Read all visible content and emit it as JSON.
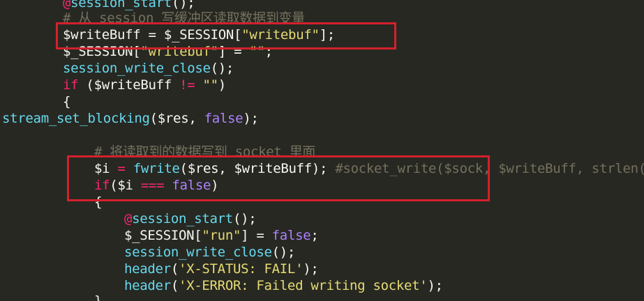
{
  "editor": {
    "language": "php",
    "theme_colors": {
      "background": "#272822",
      "keyword": "#f92672",
      "string": "#e6db74",
      "function": "#66d9ef",
      "comment": "#75715e",
      "boolean": "#ae81ff",
      "plain": "#f8f8f2",
      "annotation_box": "#d3212c"
    },
    "lines": [
      {
        "tokens": [
          {
            "t": "@",
            "c": "k"
          },
          {
            "t": "session_start",
            "c": "f"
          },
          {
            "t": "();",
            "c": "p"
          }
        ]
      },
      {
        "tokens": [
          {
            "t": "# 从 session 写缓冲区读取数据到变量",
            "c": "c"
          }
        ]
      },
      {
        "tokens": [
          {
            "t": "$writeBuff",
            "c": "v"
          },
          {
            "t": " = ",
            "c": "p"
          },
          {
            "t": "$_SESSION",
            "c": "v"
          },
          {
            "t": "[",
            "c": "p"
          },
          {
            "t": "\"writebuf\"",
            "c": "s"
          },
          {
            "t": "];",
            "c": "p"
          }
        ]
      },
      {
        "tokens": [
          {
            "t": "$_SESSION",
            "c": "v"
          },
          {
            "t": "[",
            "c": "p"
          },
          {
            "t": "\"writebuf\"",
            "c": "s"
          },
          {
            "t": "] = ",
            "c": "p"
          },
          {
            "t": "\"\"",
            "c": "s"
          },
          {
            "t": ";",
            "c": "p"
          }
        ]
      },
      {
        "tokens": [
          {
            "t": "session_write_close",
            "c": "f"
          },
          {
            "t": "();",
            "c": "p"
          }
        ]
      },
      {
        "tokens": [
          {
            "t": "if",
            "c": "k"
          },
          {
            "t": " (",
            "c": "p"
          },
          {
            "t": "$writeBuff",
            "c": "v"
          },
          {
            "t": " != ",
            "c": "k"
          },
          {
            "t": "\"\"",
            "c": "s"
          },
          {
            "t": ")",
            "c": "p"
          }
        ]
      },
      {
        "tokens": [
          {
            "t": "{",
            "c": "p"
          }
        ]
      },
      {
        "tokens": [
          {
            "t": "stream_set_blocking",
            "c": "f"
          },
          {
            "t": "(",
            "c": "p"
          },
          {
            "t": "$res",
            "c": "v"
          },
          {
            "t": ", ",
            "c": "p"
          },
          {
            "t": "false",
            "c": "b"
          },
          {
            "t": ");",
            "c": "p"
          }
        ]
      },
      {
        "tokens": [
          {
            "t": "# 将读取到的数据写到 socket 里面",
            "c": "c"
          }
        ]
      },
      {
        "tokens": [
          {
            "t": "$i",
            "c": "v"
          },
          {
            "t": " = ",
            "c": "k"
          },
          {
            "t": "fwrite",
            "c": "f"
          },
          {
            "t": "(",
            "c": "p"
          },
          {
            "t": "$res",
            "c": "v"
          },
          {
            "t": ", ",
            "c": "p"
          },
          {
            "t": "$writeBuff",
            "c": "v"
          },
          {
            "t": "); ",
            "c": "p"
          },
          {
            "t": "#socket_write($sock, $writeBuff, strlen($",
            "c": "c"
          }
        ]
      },
      {
        "tokens": [
          {
            "t": "if",
            "c": "k"
          },
          {
            "t": "(",
            "c": "p"
          },
          {
            "t": "$i",
            "c": "v"
          },
          {
            "t": " === ",
            "c": "k"
          },
          {
            "t": "false",
            "c": "b"
          },
          {
            "t": ")",
            "c": "p"
          }
        ]
      },
      {
        "tokens": [
          {
            "t": "{",
            "c": "p"
          }
        ]
      },
      {
        "tokens": [
          {
            "t": "@",
            "c": "k"
          },
          {
            "t": "session_start",
            "c": "f"
          },
          {
            "t": "();",
            "c": "p"
          }
        ]
      },
      {
        "tokens": [
          {
            "t": "$_SESSION",
            "c": "v"
          },
          {
            "t": "[",
            "c": "p"
          },
          {
            "t": "\"run\"",
            "c": "s"
          },
          {
            "t": "] = ",
            "c": "p"
          },
          {
            "t": "false",
            "c": "b"
          },
          {
            "t": ";",
            "c": "p"
          }
        ]
      },
      {
        "tokens": [
          {
            "t": "session_write_close",
            "c": "f"
          },
          {
            "t": "();",
            "c": "p"
          }
        ]
      },
      {
        "tokens": [
          {
            "t": "header",
            "c": "f"
          },
          {
            "t": "(",
            "c": "p"
          },
          {
            "t": "'X-STATUS: FAIL'",
            "c": "s"
          },
          {
            "t": ");",
            "c": "p"
          }
        ]
      },
      {
        "tokens": [
          {
            "t": "header",
            "c": "f"
          },
          {
            "t": "(",
            "c": "p"
          },
          {
            "t": "'X-ERROR: Failed writing socket'",
            "c": "s"
          },
          {
            "t": ");",
            "c": "p"
          }
        ]
      },
      {
        "tokens": [
          {
            "t": "}",
            "c": "p"
          }
        ]
      }
    ]
  }
}
